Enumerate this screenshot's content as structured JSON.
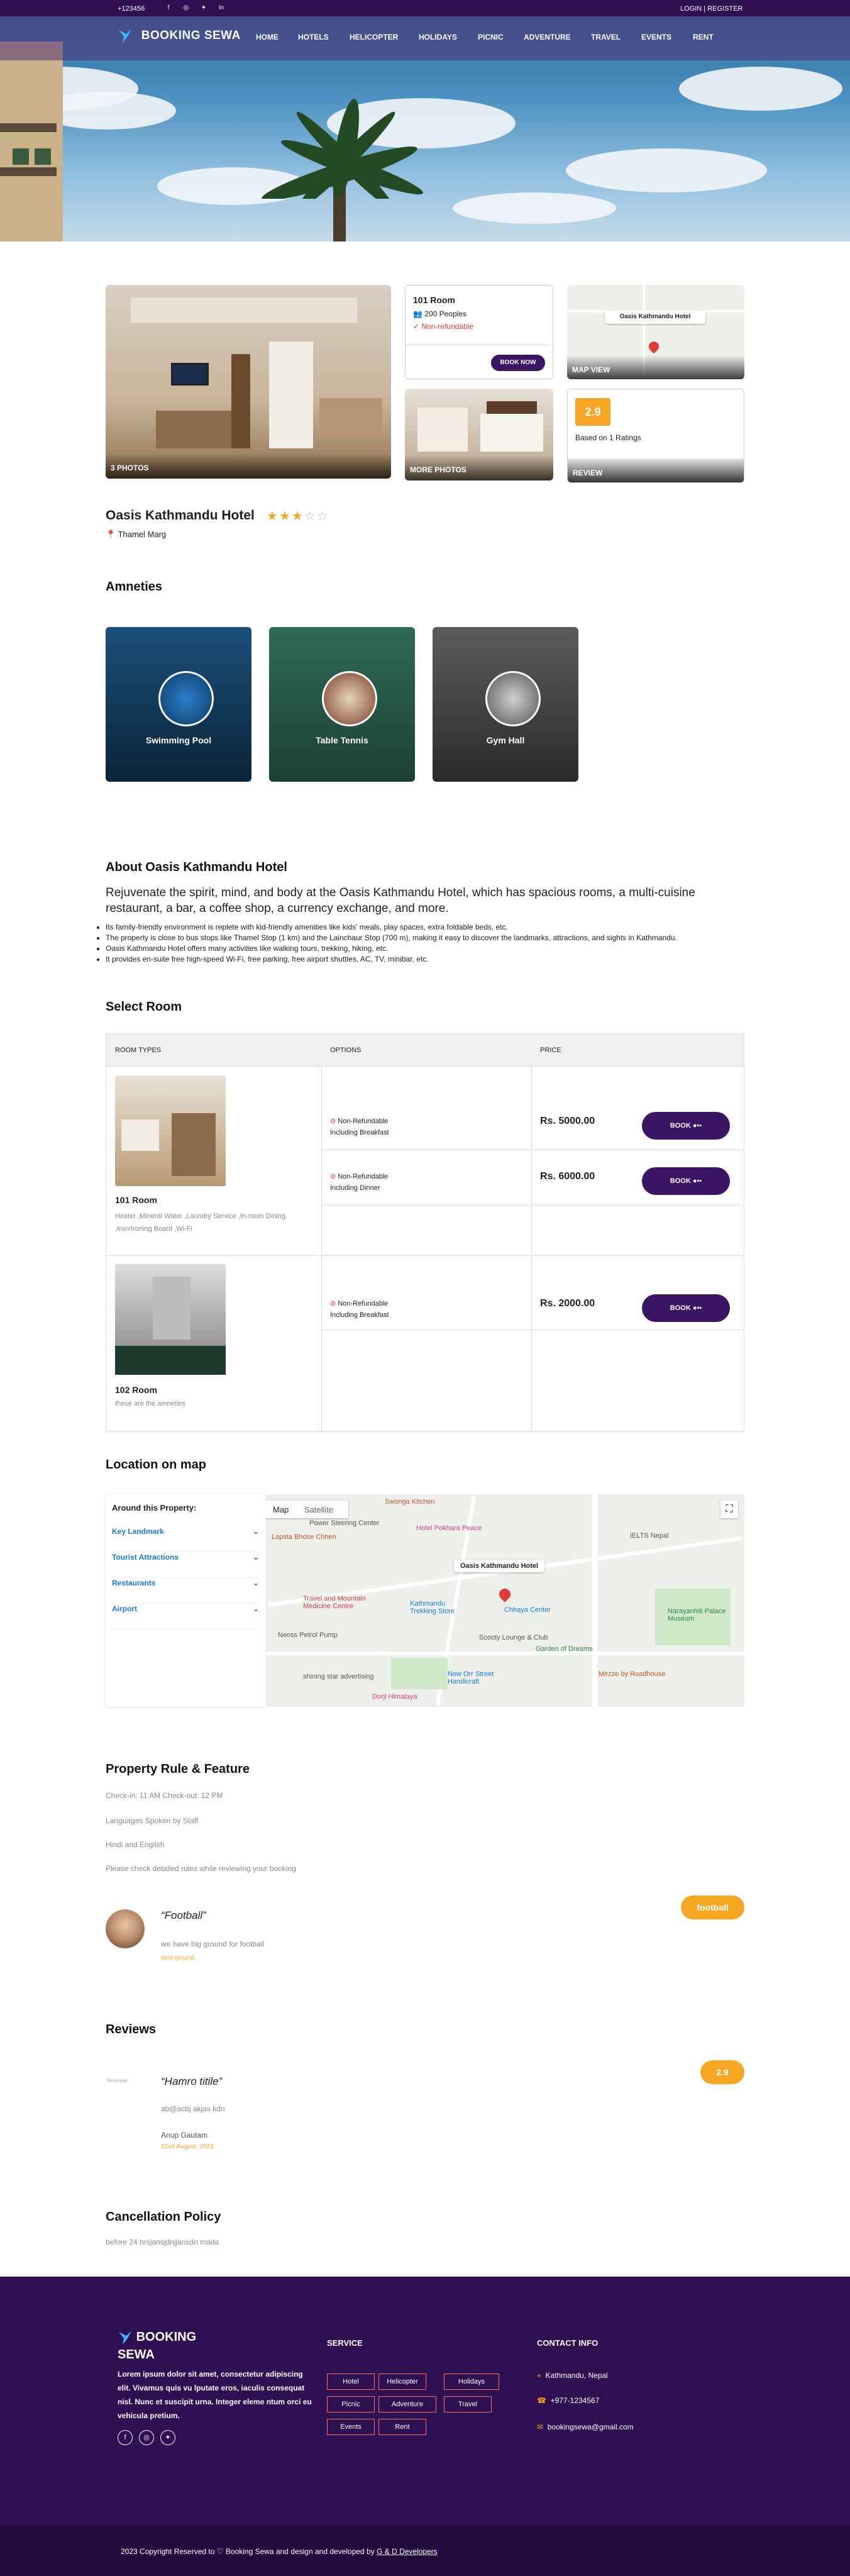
{
  "topbar": {
    "phone": "+123456",
    "login": "LOGIN | REGISTER",
    "social_icons": [
      "facebook-icon",
      "instagram-icon",
      "twitter-icon",
      "linkedin-icon"
    ]
  },
  "nav": {
    "brand": "BOOKING SEWA",
    "items": [
      "HOME",
      "HOTELS",
      "HELICOPTER",
      "HOLIDAYS",
      "PICNIC",
      "ADVENTURE",
      "TRAVEL",
      "EVENTS",
      "RENT"
    ]
  },
  "gallery": {
    "main_label": "3 PHOTOS",
    "more_label": "MORE PHOTOS",
    "map_label": "MAP VIEW",
    "map_pin_label": "Oasis Kathmandu Hotel",
    "review_label": "REVIEW"
  },
  "room_box": {
    "title": "101 Room",
    "people": "200 Peoples",
    "refund": "Non-refundable",
    "book": "BOOK NOW"
  },
  "rating_box": {
    "score": "2.9",
    "based": "Based on 1 Ratings"
  },
  "hotel": {
    "name": "Oasis Kathmandu Hotel",
    "stars": 3,
    "star_max": 5,
    "location": "Thamel Marg"
  },
  "amenities": {
    "heading": "Amneties",
    "items": [
      {
        "label": "Swimming Pool"
      },
      {
        "label": "Table Tennis"
      },
      {
        "label": "Gym Hall"
      }
    ]
  },
  "about": {
    "heading": "About Oasis Kathmandu Hotel",
    "lead": "Rejuvenate the spirit, mind, and body at the Oasis Kathmandu Hotel, which has spacious rooms, a multi-cuisine restaurant, a bar, a coffee shop, a currency exchange, and more.",
    "bullets": [
      "Its family-friendly environment is replete with kid-friendly amenities like kids' meals, play spaces, extra foldable beds, etc.",
      "The property is close to bus stops like Thamel Stop (1 km) and the Lainchaur Stop (700 m), making it easy to discover the landmarks, attractions, and sights in Kathmandu.",
      "Oasis Kathmandu Hotel offers many activities like walking tours, trekking, hiking, etc.",
      "It provides en-suite free high-speed Wi-Fi, free parking, free airport shuttles, AC, TV, minibar, etc."
    ]
  },
  "select_room": {
    "heading": "Select Room",
    "columns": [
      "ROOM TYPES",
      "OPTIONS",
      "PRICE"
    ],
    "rooms": [
      {
        "name": "101 Room",
        "amenities": "Heater ,Mineral Water ,Laundry Service ,In-room Dining ,Iron/Ironing Board ,Wi-Fi",
        "options": [
          {
            "refund": "Non-Refundable",
            "meal": "Including Breakfast",
            "price": "Rs. 5000.00",
            "book": "BOOK"
          },
          {
            "refund": "Non-Refundable",
            "meal": "Including Dinner",
            "price": "Rs. 6000.00",
            "book": "BOOK"
          }
        ]
      },
      {
        "name": "102 Room",
        "amenities": "these are the amneties",
        "options": [
          {
            "refund": "Non-Refundable",
            "meal": "Including Breakfast",
            "price": "Rs. 2000.00",
            "book": "BOOK"
          }
        ]
      }
    ]
  },
  "location": {
    "heading": "Location on map",
    "around": "Around this Property:",
    "accordion": [
      "Key Landmark",
      "Tourist Attractions",
      "Restaurants",
      "Airport"
    ],
    "map_tabs": [
      "Map",
      "Satellite"
    ],
    "map_labels": {
      "pin": "Oasis Kathmandu Hotel",
      "a": "Swonga Kitchen",
      "b": "Power Steering Center",
      "c": "Hotel Pokhara Peace",
      "d": "Lapsta Bhose Chhen",
      "e": "Travel and Mountain Medicine Centre",
      "f": "Kathmandu Trekking Store",
      "g": "Chhaya Center",
      "h": "Neoss Petrol Pump",
      "i": "Scooty Lounge & Club",
      "j": "Garden of Dreams",
      "k": "Narayanhiti Palace Museum",
      "l": "New Orr Street Handicraft",
      "m": "shining star advertising",
      "n": "Mezze by Roadhouse",
      "o": "IELTS Nepal",
      "p": "Dorji Himalaya"
    }
  },
  "rules": {
    "heading": "Property Rule & Feature",
    "lines": [
      "Check-in: 11 AM Check-out: 12 PM",
      "Languages Spoken by Staff",
      "Hindi and English",
      "Please check detailed rules while reviewing your booking"
    ],
    "quote": "“Football”",
    "quote_sub": "we have big ground for football",
    "quote_tag": "best ground",
    "badge": "football"
  },
  "reviews": {
    "heading": "Reviews",
    "avatar_alt": "Reviewer",
    "title": "“Hamro titile”",
    "body": "ab@acbj akjas kdn",
    "author": "Anup Gautam",
    "date": "22nd August, 2023",
    "score": "2.9"
  },
  "cancel": {
    "heading": "Cancellation Policy",
    "text": "before 24 hrsjansjdnjjansdn mada"
  },
  "footer": {
    "brand": "BOOKING SEWA",
    "about": "Lorem ipsum dolor sit amet, consectetur adipiscing elit. Vivamus quis vu lputate eros, iaculis consequat nisl. Nunc et suscipit urna. Integer eleme ntum orci eu vehicula pretium.",
    "service_heading": "SERVICE",
    "services": [
      "Hotel",
      "Helicopter",
      "Holidays",
      "Picnic",
      "Adventure",
      "Travel",
      "Events",
      "Rent"
    ],
    "contact_heading": "CONTACT INFO",
    "address": "Kathmandu, Nepal",
    "phone": "+977-1234567",
    "email": "bookingsewa@gmail.com",
    "copyright_pre": "2023 Copyright Reserved to ",
    "copyright_brand": "Booking Sewa and design and developed by ",
    "dev": "G & D Developers"
  },
  "colors": {
    "primary": "#2e0f52",
    "accent": "#f6a623",
    "link": "#1a7bd6",
    "danger": "#e23b3b"
  }
}
